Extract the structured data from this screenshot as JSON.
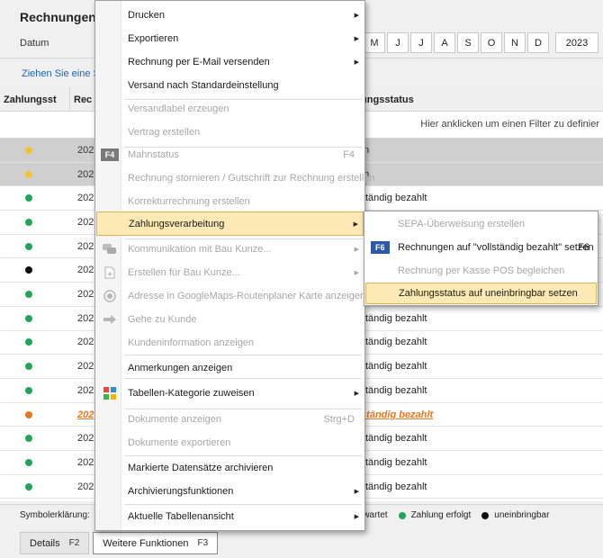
{
  "window": {
    "title": "Rechnungen",
    "datum_label": "Datum",
    "months": [
      "M",
      "J",
      "J",
      "A",
      "S",
      "O",
      "N",
      "D"
    ],
    "year": "2023",
    "group_hint": "Ziehen Sie eine S",
    "filter_hint": "Hier anklicken um einen Filter zu definier"
  },
  "grid": {
    "headers": {
      "status": "Zahlungsst",
      "rech": "Rec",
      "zahlungsstatus": "lungsstatus"
    },
    "rows": [
      {
        "dot": "#f2c230",
        "rech": "202",
        "status": "en",
        "selected": true,
        "orange": false
      },
      {
        "dot": "#f2c230",
        "rech": "202",
        "status": "en",
        "selected": true,
        "orange": false
      },
      {
        "dot": "#1fa65a",
        "rech": "202",
        "status": "lständig bezahlt",
        "selected": false,
        "orange": false
      },
      {
        "dot": "#1fa65a",
        "rech": "202",
        "status": "",
        "selected": false,
        "orange": false
      },
      {
        "dot": "#1fa65a",
        "rech": "202",
        "status": "",
        "selected": false,
        "orange": false
      },
      {
        "dot": "#111111",
        "rech": "202",
        "status": "",
        "selected": false,
        "orange": false
      },
      {
        "dot": "#1fa65a",
        "rech": "202",
        "status": "",
        "selected": false,
        "orange": false
      },
      {
        "dot": "#1fa65a",
        "rech": "202",
        "status": "lständig bezahlt",
        "selected": false,
        "orange": false
      },
      {
        "dot": "#1fa65a",
        "rech": "202",
        "status": "lständig bezahlt",
        "selected": false,
        "orange": false
      },
      {
        "dot": "#1fa65a",
        "rech": "202",
        "status": "lständig bezahlt",
        "selected": false,
        "orange": false
      },
      {
        "dot": "#1fa65a",
        "rech": "202",
        "status": "lständig bezahlt",
        "selected": false,
        "orange": false
      },
      {
        "dot": "#e87722",
        "rech": "202",
        "status": "lständig bezahlt",
        "selected": false,
        "orange": true
      },
      {
        "dot": "#1fa65a",
        "rech": "202",
        "status": "lständig bezahlt",
        "selected": false,
        "orange": false
      },
      {
        "dot": "#1fa65a",
        "rech": "202",
        "status": "lständig bezahlt",
        "selected": false,
        "orange": false
      },
      {
        "dot": "#1fa65a",
        "rech": "202",
        "status": "lständig bezahlt",
        "selected": false,
        "orange": false
      }
    ]
  },
  "legend": {
    "label": "Symbolerklärung:",
    "items": [
      {
        "text": "rwartet",
        "color": ""
      },
      {
        "text": "Zahlung erfolgt",
        "color": "#1fa65a"
      },
      {
        "text": "uneinbringbar",
        "color": "#111111"
      }
    ]
  },
  "bottom_buttons": [
    {
      "label": "Details",
      "shortcut": "F2",
      "active": false
    },
    {
      "label": "Weitere Funktionen",
      "shortcut": "F3",
      "active": true
    }
  ],
  "menu": {
    "items": [
      {
        "label": "Drucken",
        "submenu": true,
        "disabled": false,
        "icon": ""
      },
      {
        "label": "Exportieren",
        "submenu": true,
        "disabled": false,
        "icon": ""
      },
      {
        "label": "Rechnung per E-Mail versenden",
        "submenu": true,
        "disabled": false,
        "icon": ""
      },
      {
        "label": "Versand nach Standardeinstellung",
        "submenu": false,
        "disabled": false,
        "icon": ""
      },
      {
        "label": "Versandlabel erzeugen",
        "submenu": false,
        "disabled": true,
        "icon": ""
      },
      {
        "label": "Vertrag erstellen",
        "submenu": false,
        "disabled": true,
        "icon": ""
      },
      {
        "label": "Mahnstatus",
        "submenu": false,
        "disabled": true,
        "icon": "f4-badge",
        "shortcut": "F4",
        "badge": "F4"
      },
      {
        "label": "Rechnung stornieren / Gutschrift zur Rechnung erstellen",
        "submenu": false,
        "disabled": true,
        "icon": ""
      },
      {
        "label": "Korrekturrechnung erstellen",
        "submenu": false,
        "disabled": true,
        "icon": ""
      },
      {
        "label": "Zahlungsverarbeitung",
        "submenu": true,
        "disabled": false,
        "icon": "",
        "highlighted": true
      },
      {
        "label": "Kommunikation mit Bau Kunze...",
        "submenu": true,
        "disabled": true,
        "icon": "chat-icon"
      },
      {
        "label": "Erstellen für Bau Kunze...",
        "submenu": true,
        "disabled": true,
        "icon": "document-plus-icon"
      },
      {
        "label": "Adresse in GoogleMaps-Routenplaner Karte anzeigen",
        "submenu": false,
        "disabled": true,
        "icon": "target-icon"
      },
      {
        "label": "Gehe zu Kunde",
        "submenu": false,
        "disabled": true,
        "icon": "arrow-right-icon"
      },
      {
        "label": "Kundeninformation anzeigen",
        "submenu": false,
        "disabled": true,
        "icon": ""
      },
      {
        "label": "Anmerkungen anzeigen",
        "submenu": false,
        "disabled": false,
        "icon": ""
      },
      {
        "label": "Tabellen-Kategorie zuweisen",
        "submenu": true,
        "disabled": false,
        "icon": "color-grid-icon"
      },
      {
        "label": "Dokumente anzeigen",
        "submenu": false,
        "disabled": true,
        "icon": "",
        "shortcut": "Strg+D"
      },
      {
        "label": "Dokumente exportieren",
        "submenu": false,
        "disabled": true,
        "icon": ""
      },
      {
        "label": "Markierte Datensätze archivieren",
        "submenu": false,
        "disabled": false,
        "icon": ""
      },
      {
        "label": "Archivierungsfunktionen",
        "submenu": true,
        "disabled": false,
        "icon": ""
      },
      {
        "label": "Aktuelle Tabellenansicht",
        "submenu": true,
        "disabled": false,
        "icon": ""
      }
    ]
  },
  "submenu": {
    "items": [
      {
        "label": "SEPA-Überweisung erstellen",
        "disabled": true
      },
      {
        "label": "Rechnungen auf \"vollständig bezahlt\" setzen",
        "disabled": false,
        "badge": "F6",
        "shortcut": "F6"
      },
      {
        "label": "Rechnung per Kasse POS begleichen",
        "disabled": true
      },
      {
        "label": "Zahlungsstatus auf uneinbringbar setzen",
        "disabled": false,
        "highlighted": true
      }
    ]
  }
}
